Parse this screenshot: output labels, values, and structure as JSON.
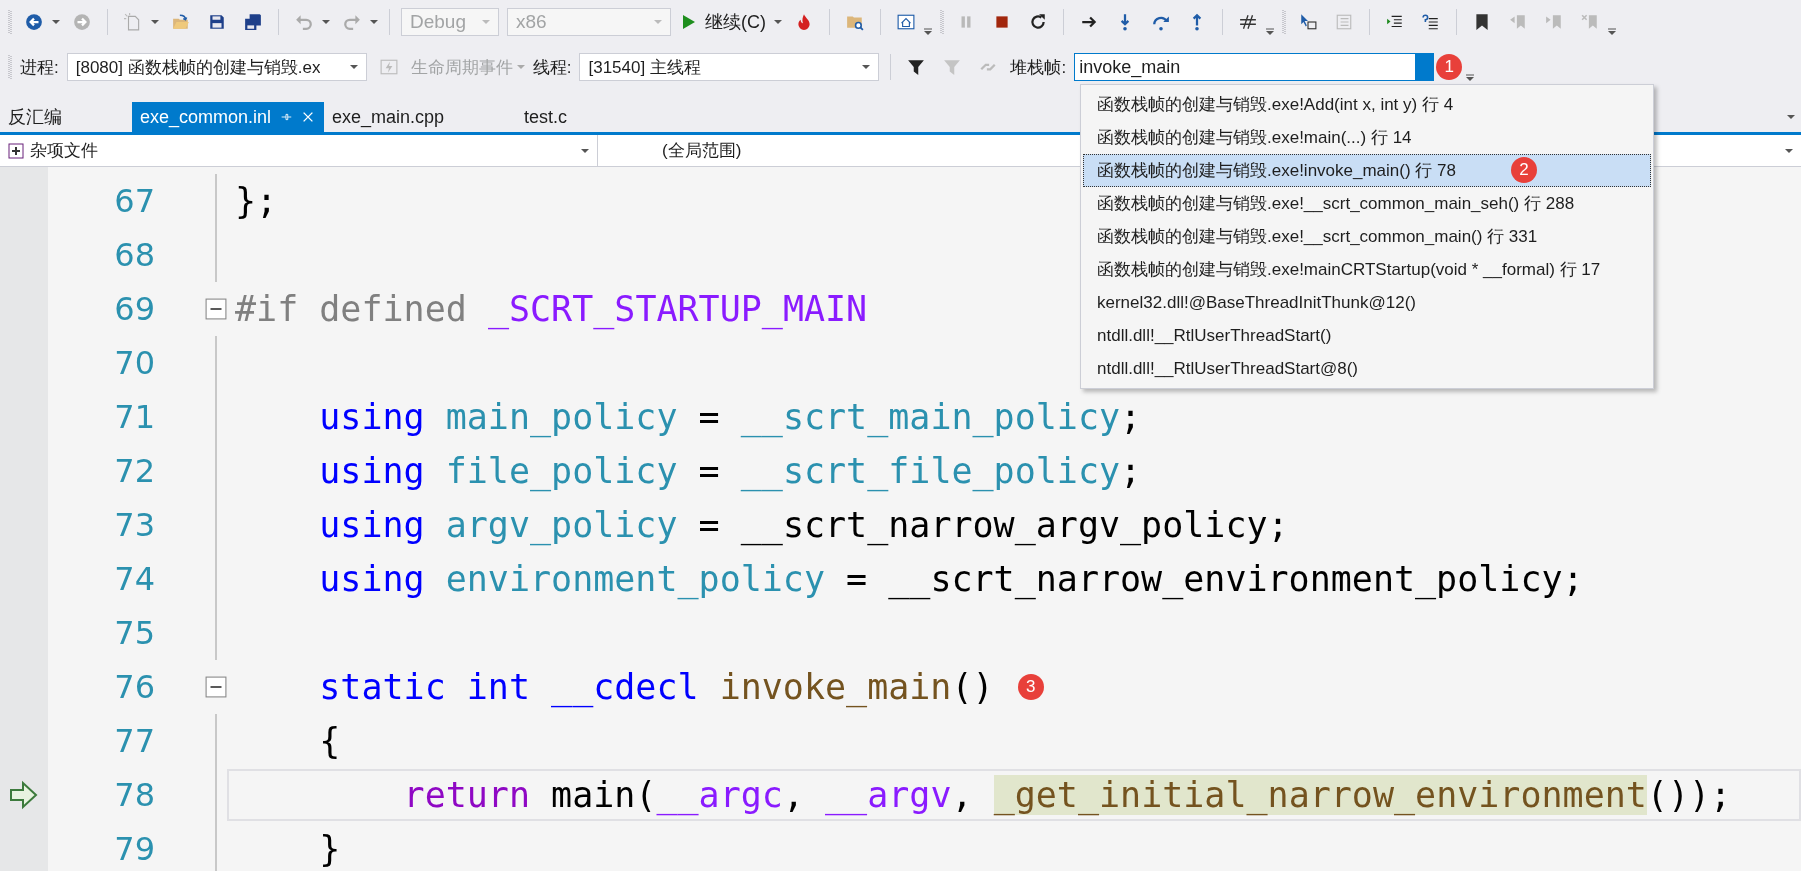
{
  "toolbar": {
    "configuration": {
      "value": "Debug",
      "disabled": true
    },
    "platform": {
      "value": "x86",
      "disabled": true
    },
    "continue_button": {
      "label": "继续(C)"
    }
  },
  "debug_location": {
    "process_label": "进程:",
    "process": "[8080] 函数栈帧的创建与销毁.ex",
    "lifecycle": {
      "label": "生命周期事件",
      "disabled": true
    },
    "thread_label": "线程:",
    "thread": "[31540] 主线程",
    "stack_frame_label": "堆栈帧:",
    "stack_frame": {
      "value": "invoke_main",
      "badge": "1"
    }
  },
  "stack_frame_list": [
    {
      "text": "函数栈帧的创建与销毁.exe!Add(int x, int y) 行 4",
      "selected": false
    },
    {
      "text": "函数栈帧的创建与销毁.exe!main(...) 行 14",
      "selected": false
    },
    {
      "text": "函数栈帧的创建与销毁.exe!invoke_main() 行 78",
      "selected": true,
      "badge": "2"
    },
    {
      "text": "函数栈帧的创建与销毁.exe!__scrt_common_main_seh() 行 288",
      "selected": false
    },
    {
      "text": "函数栈帧的创建与销毁.exe!__scrt_common_main() 行 331",
      "selected": false
    },
    {
      "text": "函数栈帧的创建与销毁.exe!mainCRTStartup(void * __formal) 行 17",
      "selected": false
    },
    {
      "text": "kernel32.dll!@BaseThreadInitThunk@12()",
      "selected": false
    },
    {
      "text": "ntdll.dll!__RtlUserThreadStart()",
      "selected": false
    },
    {
      "text": "ntdll.dll!__RtlUserThreadStart@8()",
      "selected": false
    }
  ],
  "disassembly_tab": {
    "label": "反汇编",
    "selected": false
  },
  "tabs": [
    {
      "label": "exe_common.inl",
      "selected": true
    },
    {
      "label": "exe_main.cpp",
      "selected": false
    },
    {
      "label": "test.c",
      "selected": false
    }
  ],
  "navigation": {
    "project": "杂项文件",
    "scope": "(全局范围)"
  },
  "editor": {
    "lines": [
      {
        "number": "67",
        "fold": false,
        "current": false,
        "tokens": [
          {
            "kind": "plain",
            "text": "};"
          }
        ]
      },
      {
        "number": "68",
        "fold": false,
        "current": false
      },
      {
        "number": "69",
        "fold": true,
        "current": false,
        "tokens": [
          {
            "kind": "pp",
            "text": "#if defined "
          },
          {
            "kind": "macro",
            "text": "_SCRT_STARTUP_MAIN"
          }
        ]
      },
      {
        "number": "70",
        "fold": false,
        "current": false
      },
      {
        "number": "71",
        "fold": false,
        "current": false,
        "tokens": [
          {
            "kind": "kw",
            "text": "    using "
          },
          {
            "kind": "type",
            "text": "main_policy"
          },
          {
            "kind": "plain",
            "text": " = "
          },
          {
            "kind": "type",
            "text": "__scrt_main_policy"
          },
          {
            "kind": "plain",
            "text": ";"
          }
        ]
      },
      {
        "number": "72",
        "fold": false,
        "current": false,
        "tokens": [
          {
            "kind": "kw",
            "text": "    using "
          },
          {
            "kind": "type",
            "text": "file_policy"
          },
          {
            "kind": "plain",
            "text": " = "
          },
          {
            "kind": "type",
            "text": "__scrt_file_policy"
          },
          {
            "kind": "plain",
            "text": ";"
          }
        ]
      },
      {
        "number": "73",
        "fold": false,
        "current": false,
        "tokens": [
          {
            "kind": "kw",
            "text": "    using "
          },
          {
            "kind": "type",
            "text": "argv_policy"
          },
          {
            "kind": "plain",
            "text": " = "
          },
          {
            "kind": "plain",
            "text": "__scrt_narrow_argv_policy;"
          }
        ]
      },
      {
        "number": "74",
        "fold": false,
        "current": false,
        "tokens": [
          {
            "kind": "kw",
            "text": "    using "
          },
          {
            "kind": "type",
            "text": "environment_policy"
          },
          {
            "kind": "plain",
            "text": " = "
          },
          {
            "kind": "plain",
            "text": "__scrt_narrow_environment_policy;"
          }
        ]
      },
      {
        "number": "75",
        "fold": false,
        "current": false
      },
      {
        "number": "76",
        "fold": true,
        "current": false,
        "badge": "3",
        "tokens": [
          {
            "kind": "kw",
            "text": "    static int __cdecl "
          },
          {
            "kind": "fn",
            "text": "invoke_main"
          },
          {
            "kind": "plain",
            "text": "()"
          }
        ]
      },
      {
        "number": "77",
        "fold": false,
        "current": false,
        "tokens": [
          {
            "kind": "plain",
            "text": "    {"
          }
        ]
      },
      {
        "number": "78",
        "fold": false,
        "current": true,
        "tokens": [
          {
            "kind": "ctl",
            "text": "        return "
          },
          {
            "kind": "plain",
            "text": "main("
          },
          {
            "kind": "macro",
            "text": "__argc"
          },
          {
            "kind": "plain",
            "text": ", "
          },
          {
            "kind": "macro",
            "text": "__argv"
          },
          {
            "kind": "plain",
            "text": ", "
          },
          {
            "kind": "fn",
            "text": "_get_initial_narrow_environment",
            "highlighted": true
          },
          {
            "kind": "plain",
            "text": "());"
          }
        ]
      },
      {
        "number": "79",
        "fold": false,
        "current": false,
        "tokens": [
          {
            "kind": "plain",
            "text": "    }"
          }
        ]
      }
    ]
  }
}
